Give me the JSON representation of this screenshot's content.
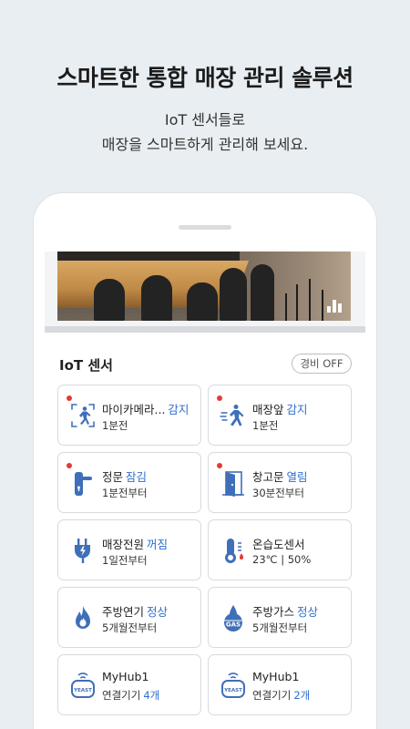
{
  "headline": "스마트한 통합 매장 관리 솔루션",
  "sub_line1": "IoT 센서들로",
  "sub_line2": "매장을 스마트하게 관리해 보세요.",
  "colors": {
    "accent": "#2d6fd1",
    "alert": "#e53935",
    "icon": "#3f6fb8"
  },
  "panel": {
    "title": "IoT 센서",
    "alarm_button": "경비 OFF"
  },
  "sensors": [
    {
      "name": "마이카메라...",
      "status": "감지",
      "detail": "1분전",
      "icon": "motion-person-icon",
      "alert": true
    },
    {
      "name": "매장앞",
      "status": "감지",
      "detail": "1분전",
      "icon": "motion-person-icon",
      "alert": true
    },
    {
      "name": "정문",
      "status": "잠김",
      "detail": "1분전부터",
      "icon": "door-lock-icon",
      "alert": true
    },
    {
      "name": "창고문",
      "status": "열림",
      "detail": "30분전부터",
      "icon": "door-open-icon",
      "alert": true
    },
    {
      "name": "매장전원",
      "status": "꺼짐",
      "detail": "1일전부터",
      "icon": "power-plug-icon",
      "alert": false
    },
    {
      "name": "온습도센서",
      "status": "",
      "detail": "23℃ | 50%",
      "icon": "thermometer-icon",
      "alert": false
    },
    {
      "name": "주방연기",
      "status": "정상",
      "detail": "5개월전부터",
      "icon": "fire-icon",
      "alert": false
    },
    {
      "name": "주방가스",
      "status": "정상",
      "detail": "5개월전부터",
      "icon": "gas-icon",
      "alert": false
    },
    {
      "name": "MyHub1",
      "status": "",
      "detail_label": "연결기기",
      "detail_count": "4개",
      "icon": "hub-icon",
      "hub_label": "YEAST",
      "alert": false
    },
    {
      "name": "MyHub1",
      "status": "",
      "detail_label": "연결기기",
      "detail_count": "2개",
      "icon": "hub-icon",
      "hub_label": "YEAST",
      "alert": false
    }
  ]
}
